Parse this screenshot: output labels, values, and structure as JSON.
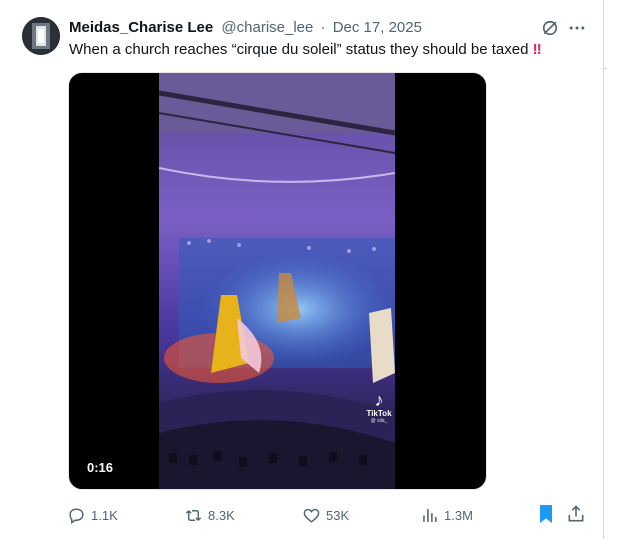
{
  "post": {
    "display_name": "Meidas_Charise Lee",
    "handle": "@charise_lee",
    "separator": "·",
    "date": "Dec 17, 2025",
    "text": "When a church reaches “cirque du soleil” status they should be taxed",
    "emoji": "‼"
  },
  "media": {
    "duration": "0:16",
    "watermark": "TikTok",
    "watermark_user": "@ xila_"
  },
  "actions": {
    "replies": "1.1K",
    "reposts": "8.3K",
    "likes": "53K",
    "views": "1.3M"
  },
  "colors": {
    "text_primary": "#0f1419",
    "text_secondary": "#536471",
    "bookmark_active": "#1d9bf0",
    "emoji_red": "#e0245e"
  },
  "icons": [
    "avatar",
    "grok-icon",
    "more-icon",
    "reply-icon",
    "retweet-icon",
    "like-icon",
    "views-icon",
    "bookmark-icon",
    "share-icon",
    "tiktok-logo"
  ]
}
